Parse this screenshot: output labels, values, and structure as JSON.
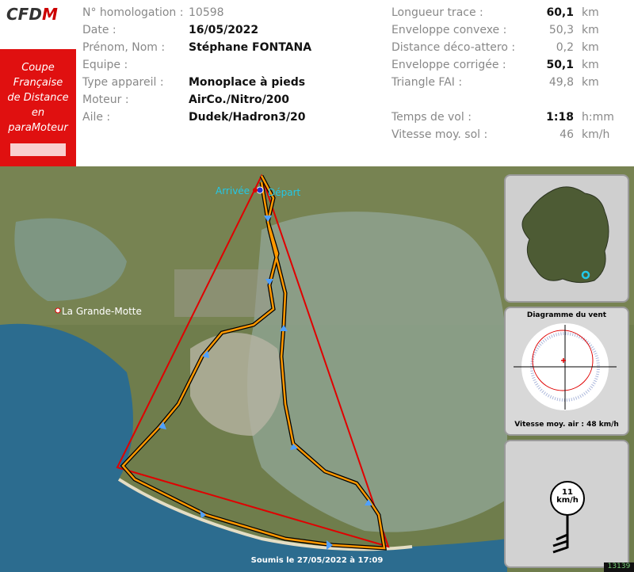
{
  "brand": {
    "logo_text": "CFDM",
    "sidebar_lines": [
      "Coupe",
      "Française",
      "de Distance",
      "en",
      "paraMoteur"
    ]
  },
  "pilot_info": {
    "homologation_label": "N° homologation :",
    "homologation_value": "10598",
    "date_label": "Date :",
    "date_value": "16/05/2022",
    "name_label": "Prénom, Nom :",
    "name_value": "Stéphane FONTANA",
    "team_label": "Equipe :",
    "team_value": "",
    "aircraft_label": "Type appareil :",
    "aircraft_value": "Monoplace à pieds",
    "engine_label": "Moteur :",
    "engine_value": "AirCo./Nitro/200",
    "wing_label": "Aile :",
    "wing_value": "Dudek/Hadron3/20"
  },
  "stats": {
    "track_label": "Longueur trace :",
    "track_value": "60,1",
    "track_unit": "km",
    "hull_label": "Enveloppe convexe :",
    "hull_value": "50,3",
    "hull_unit": "km",
    "deco_label": "Distance déco-attero :",
    "deco_value": "0,2",
    "deco_unit": "km",
    "corrected_label": "Enveloppe corrigée :",
    "corrected_value": "50,1",
    "corrected_unit": "km",
    "fai_label": "Triangle FAI :",
    "fai_value": "49,8",
    "fai_unit": "km",
    "time_label": "Temps de vol :",
    "time_value": "1:18",
    "time_unit": "h:mm",
    "speed_label": "Vitesse moy. sol :",
    "speed_value": "46",
    "speed_unit": "km/h"
  },
  "map": {
    "arrival_label": "Arrivée",
    "departure_label": "Départ",
    "town_label": "La Grande-Motte",
    "footer": "Soumis le 27/05/2022 à 17:09",
    "badge": "13139"
  },
  "wind": {
    "title": "Diagramme du vent",
    "airspeed": "Vitesse moy. air : 48 km/h",
    "speed_value": "11",
    "speed_unit": "km/h"
  },
  "colors": {
    "brand_red": "#e01010",
    "track_orange": "#ff9900",
    "triangle_red": "#e00000",
    "marker_cyan": "#22c8e8"
  }
}
